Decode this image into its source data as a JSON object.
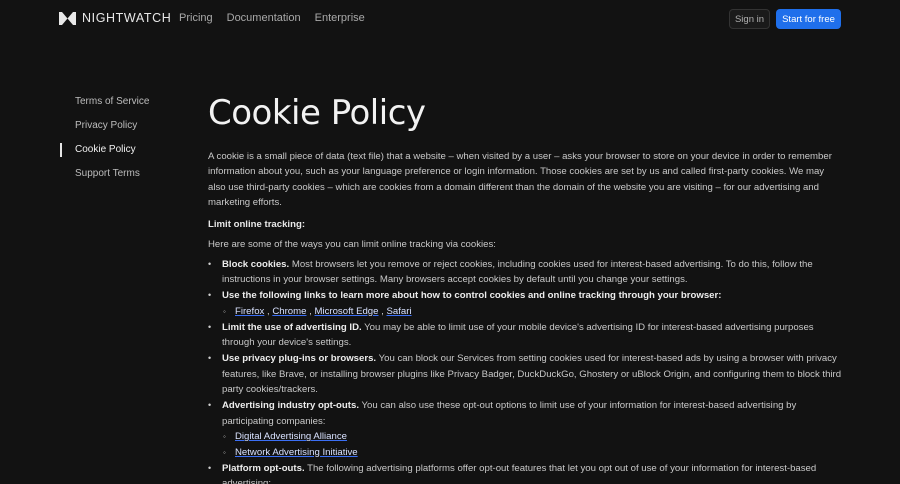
{
  "header": {
    "logo_text": "NIGHTWATCH",
    "nav": [
      "Pricing",
      "Documentation",
      "Enterprise"
    ],
    "signin_label": "Sign in",
    "start_label": "Start for free",
    "accent_color": "#1f6feb"
  },
  "sidebar": {
    "items": [
      {
        "label": "Terms of Service"
      },
      {
        "label": "Privacy Policy"
      },
      {
        "label": "Cookie Policy",
        "active": true
      },
      {
        "label": "Support Terms"
      }
    ]
  },
  "main": {
    "title": "Cookie Policy",
    "intro_paragraph": "A cookie is a small piece of data (text file) that a website – when visited by a user – asks your browser to store on your device in order to remember information about you, such as your language preference or login information. Those cookies are set by us and called first-party cookies. We may also use third-party cookies – which are cookies from a domain different than the domain of the website you are visiting – for our advertising and marketing efforts.",
    "section_heading": "Limit online tracking:",
    "section_intro": "Here are some of the ways you can limit online tracking via cookies:",
    "bullets": [
      {
        "bold": "Block cookies.",
        "text": " Most browsers let you remove or reject cookies, including cookies used for interest-based advertising. To do this, follow the instructions in your browser settings. Many browsers accept cookies by default until you change your settings."
      },
      {
        "bold": "Use the following links to learn more about how to control cookies and online tracking through your browser:",
        "text": ""
      },
      {
        "bold": "Limit the use of advertising ID.",
        "text": " You may be able to limit use of your mobile device's advertising ID for interest-based advertising purposes through your device's settings."
      },
      {
        "bold": "Use privacy plug-ins or browsers.",
        "text": " You can block our Services from setting cookies used for interest-based ads by using a browser with privacy features, like Brave, or installing browser plugins like Privacy Badger, DuckDuckGo, Ghostery or uBlock Origin, and configuring them to block third party cookies/trackers."
      },
      {
        "bold": "Advertising industry opt-outs.",
        "text": " You can also use these opt-out options to limit use of your information for interest-based advertising by participating companies:"
      },
      {
        "bold": "Platform opt-outs.",
        "text": " The following advertising platforms offer opt-out features that let you opt out of use of your information for interest-based advertising:"
      }
    ],
    "browser_links": [
      "Firefox",
      "Chrome",
      "Microsoft Edge",
      "Safari"
    ],
    "browser_sep": ",",
    "industry_links": [
      "Digital Advertising Alliance",
      "Network Advertising Initiative"
    ]
  }
}
